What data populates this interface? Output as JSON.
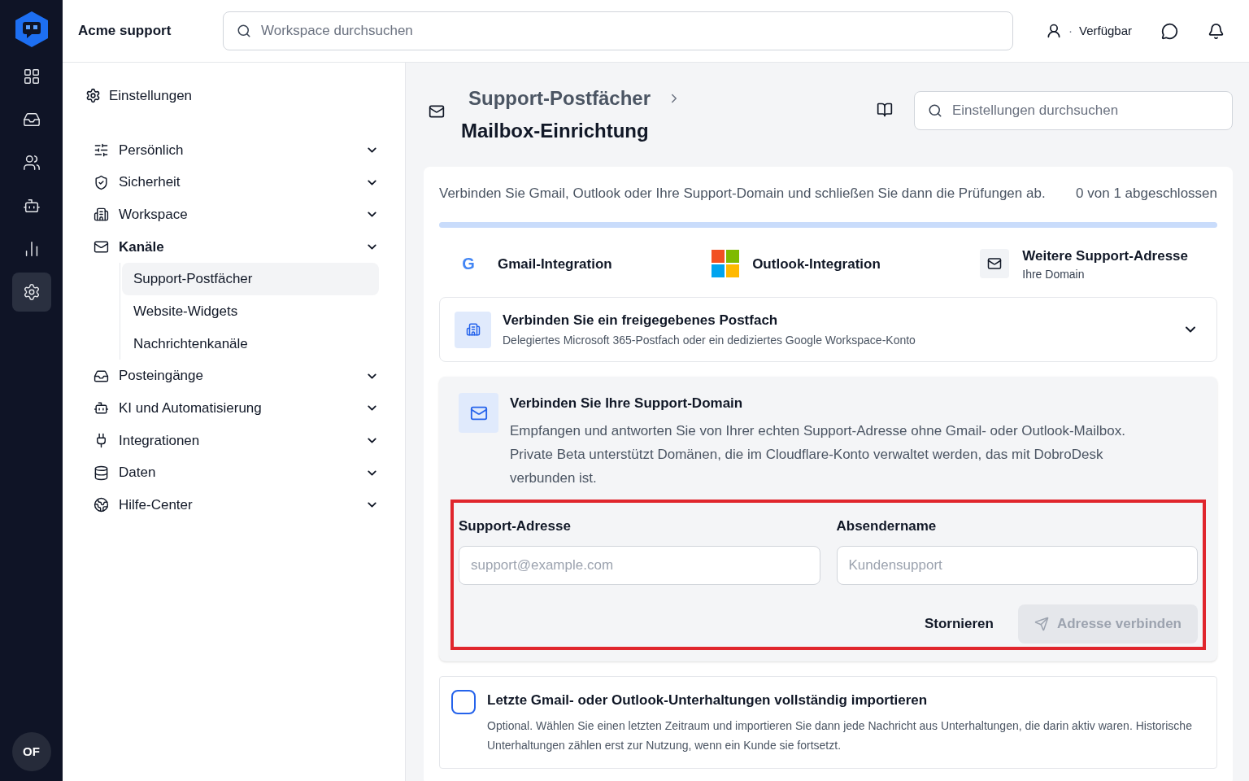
{
  "workspace": {
    "name": "Acme support",
    "search_placeholder": "Workspace durchsuchen",
    "status": "Verfügbar",
    "status_separator": "·",
    "avatar": "OF"
  },
  "rail": [
    {
      "selected": false
    },
    {
      "selected": false
    },
    {
      "selected": false
    },
    {
      "selected": false
    },
    {
      "selected": false
    },
    {
      "selected": true
    }
  ],
  "settings_nav": {
    "title": "Einstellungen",
    "items": [
      {
        "label": "Persönlich",
        "selected": false
      },
      {
        "label": "Sicherheit",
        "selected": false
      },
      {
        "label": "Workspace",
        "selected": false
      },
      {
        "label": "Kanäle",
        "selected": true,
        "children": [
          {
            "label": "Support-Postfächer",
            "selected": true
          },
          {
            "label": "Website-Widgets",
            "selected": false
          },
          {
            "label": "Nachrichtenkanäle",
            "selected": false
          }
        ]
      },
      {
        "label": "Posteingänge",
        "selected": false
      },
      {
        "label": "KI und Automatisierung",
        "selected": false
      },
      {
        "label": "Integrationen",
        "selected": false
      },
      {
        "label": "Daten",
        "selected": false
      },
      {
        "label": "Hilfe-Center",
        "selected": false
      }
    ]
  },
  "header": {
    "breadcrumb": "Support-Postfächer",
    "title": "Mailbox-Einrichtung",
    "search_placeholder": "Einstellungen durchsuchen"
  },
  "setup": {
    "intro": "Verbinden Sie Gmail, Outlook oder Ihre Support-Domain und schließen Sie dann die Prüfungen ab.",
    "progress_text": "0 von 1 abgeschlossen",
    "level": 0,
    "options": [
      {
        "kind": "gmail",
        "title": "Gmail-Integration",
        "glyph": "G"
      },
      {
        "kind": "outlook",
        "title": "Outlook-Integration"
      },
      {
        "kind": "domain",
        "title": "Weitere Support-Adresse",
        "subtitle": "Ihre Domain"
      }
    ],
    "shared": {
      "title": "Verbinden Sie ein freigegebenes Postfach",
      "subtitle": "Delegiertes Microsoft 365-Postfach oder ein dediziertes Google Workspace-Konto"
    },
    "domain": {
      "title": "Verbinden Sie Ihre Support-Domain",
      "text": "Empfangen und antworten Sie von Ihrer echten Support-Adresse ohne Gmail- oder Outlook-Mailbox. Private Beta unterstützt Domänen, die im Cloudflare-Konto verwaltet werden, das mit DobroDesk verbunden ist.",
      "fields": [
        {
          "label": "Support-Adresse",
          "placeholder": "support@example.com"
        },
        {
          "label": "Absendername",
          "placeholder": "Kundensupport"
        }
      ],
      "cancel": "Stornieren",
      "submit": {
        "label": "Adresse verbinden",
        "disabled": true
      }
    },
    "import": {
      "checked": false,
      "title": "Letzte Gmail- oder Outlook-Unterhaltungen vollständig importieren",
      "text": "Optional. Wählen Sie einen letzten Zeitraum und importieren Sie dann jede Nachricht aus Unterhaltungen, die darin aktiv waren. Historische Unterhaltungen zählen erst zur Nutzung, wenn ein Kunde sie fortsetzt."
    }
  }
}
